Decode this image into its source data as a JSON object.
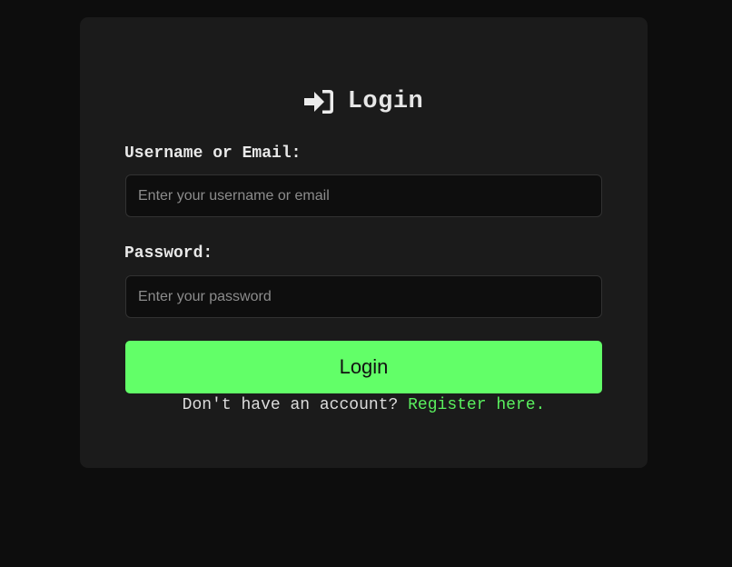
{
  "login_card": {
    "title": "Login",
    "title_icon": "sign-in-icon",
    "username_label": "Username or Email:",
    "username_placeholder": "Enter your username or email",
    "username_value": "",
    "password_label": "Password:",
    "password_placeholder": "Enter your password",
    "password_value": "",
    "submit_label": "Login",
    "register_prompt": "Don't have an account?",
    "register_link": "Register here."
  },
  "colors": {
    "page_background": "#0d0d0d",
    "card_background": "#1b1b1b",
    "accent": "#62ff68",
    "link": "#5af05e"
  }
}
